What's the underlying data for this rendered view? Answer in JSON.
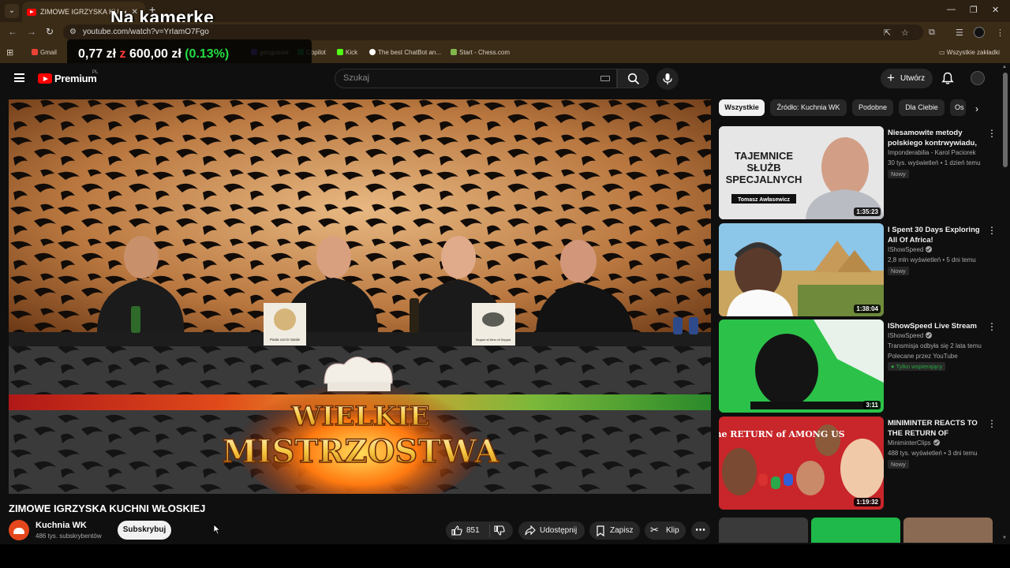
{
  "browser": {
    "tab_title": "ZIMOWE IGRZYSKA KUCHNI WŁOSKIEJ",
    "overlay_title": "Na kamerke",
    "url": "youtube.com/watch?v=YrIamO7Fgo",
    "bookmarks": [
      {
        "label": "Gmail",
        "color": "#ea4335"
      },
      {
        "label": "geoguessr",
        "color": "#6b5bd2"
      },
      {
        "label": "Copilot",
        "color": "#2a8c3c"
      },
      {
        "label": "Kick",
        "color": "#53fc18"
      },
      {
        "label": "The best ChatBot an...",
        "color": "#ffffff"
      },
      {
        "label": "Start - Chess.com",
        "color": "#81b64c"
      }
    ],
    "all_bookmarks": "Wszystkie zakładki"
  },
  "price_ticker": {
    "amount": "0,77 zł",
    "separator": "z",
    "goal": "600,00 zł",
    "percent": "(0.13%)"
  },
  "header": {
    "logo_text": "Premium",
    "logo_region": "PL",
    "search_placeholder": "Szukaj",
    "create_label": "Utwórz"
  },
  "video": {
    "title": "ZIMOWE IGRZYSKA KUCHNI WŁOSKIEJ",
    "overlay_line1": "WIELKIE",
    "overlay_line2": "MISTRZOSTWA",
    "card_left": "Pasta con le Sarde",
    "card_right": "Seppie al Nero di Seppia",
    "channel_name": "Kuchnia WK",
    "subscribers": "486 tys. subskrybentów",
    "subscribe_label": "Subskrybuj",
    "likes": "851",
    "share_label": "Udostępnij",
    "save_label": "Zapisz",
    "clip_label": "Klip"
  },
  "chips": [
    "Wszystkie",
    "Źródło: Kuchnia WK",
    "Podobne",
    "Dla Ciebie",
    "Os"
  ],
  "recommendations": [
    {
      "title": "Niesamowite metody polskiego kontrwywiadu, ...",
      "channel": "Imponderabilia - Karol Paciorek",
      "meta": "30 tys. wyświetleń • 1 dzień temu",
      "badge": "Nowy",
      "duration": "1:35:23",
      "thumb_line1": "TAJEMNICE",
      "thumb_line2": "SŁUŻB",
      "thumb_line3": "SPECJALNYCH",
      "thumb_name": "Tomasz Awłasewicz"
    },
    {
      "title": "I Spent 30 Days Exploring All Of Africa!",
      "channel": "IShowSpeed",
      "meta": "2,8 mln wyświetleń • 5 dni temu",
      "badge": "Nowy",
      "duration": "1:38:04"
    },
    {
      "title": "IShowSpeed Live Stream",
      "channel": "IShowSpeed",
      "meta": "Transmisja odbyła się 2 lata temu",
      "meta2": "Polecane przez YouTube",
      "badge": "Tylko wspierający",
      "duration": "3:11"
    },
    {
      "title": "MINIMINTER REACTS TO THE RETURN OF SIDEMEN...",
      "channel": "MiniminterClips",
      "meta": "488 tys. wyświetleń • 3 dni temu",
      "badge": "Nowy",
      "duration": "1:19:32",
      "thumb_text": "the RETURN of AMONG US"
    }
  ],
  "colors": {
    "accent_red": "#ff0000",
    "chrome_bg": "#3b2c18",
    "page_bg": "#0f0f0f",
    "member_green": "#2ba640"
  }
}
